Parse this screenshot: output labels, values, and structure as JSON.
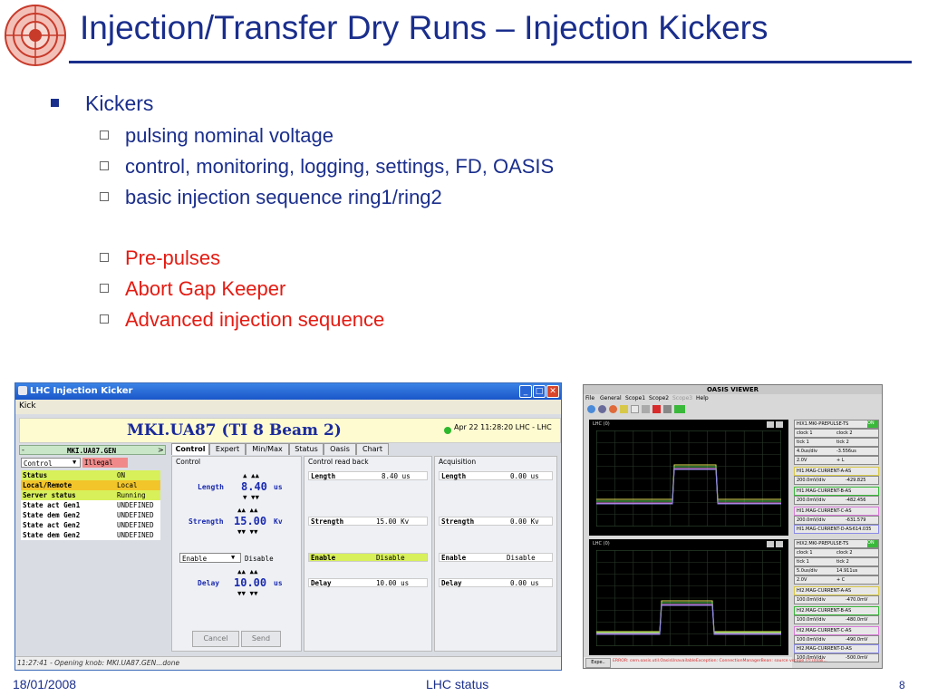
{
  "slide": {
    "title": "Injection/Transfer Dry Runs – Injection Kickers",
    "bullet": "Kickers",
    "sub_blue": [
      "pulsing nominal voltage",
      "control, monitoring, logging, settings, FD, OASIS",
      "basic injection sequence ring1/ring2"
    ],
    "sub_red": [
      "Pre-pulses",
      "Abort Gap Keeper",
      "Advanced injection sequence"
    ]
  },
  "footer": {
    "date": "18/01/2008",
    "center": "LHC status",
    "page": "8"
  },
  "colors": {
    "title_blue": "#1a2e8c",
    "red": "#e41b12"
  },
  "kicker_window": {
    "title": "LHC Injection Kicker",
    "menu": "Kick",
    "header_title": "MKI.UA87 (TI 8 Beam 2)",
    "header_time": "Apr 22 11:28:20  LHC - LHC",
    "device": "MKI.UA87.GEN",
    "mode_select": "Control",
    "mode_state": "Illegal",
    "tabs": [
      "Control",
      "Expert",
      "Min/Max",
      "Status",
      "Oasis",
      "Chart"
    ],
    "status_rows": [
      {
        "label": "Status",
        "value": "ON"
      },
      {
        "label": "Local/Remote",
        "value": "Local"
      },
      {
        "label": "Server status",
        "value": "Running"
      },
      {
        "label": "State act Gen1",
        "value": "UNDEFINED"
      },
      {
        "label": "State dem Gen2",
        "value": "UNDEFINED"
      },
      {
        "label": "State act Gen2",
        "value": "UNDEFINED"
      },
      {
        "label": "State dem Gen2",
        "value": "UNDEFINED"
      }
    ],
    "control": {
      "panel_title": "Control",
      "length_label": "Length",
      "length_value": "8.40",
      "length_unit": "us",
      "strength_label": "Strength",
      "strength_value": "15.00",
      "strength_unit": "Kv",
      "enable_select": "Enable",
      "enable_state": "Disable",
      "delay_label": "Delay",
      "delay_value": "10.00",
      "delay_unit": "us",
      "cancel": "Cancel",
      "send": "Send"
    },
    "readback": {
      "panel_title": "Control read back",
      "rows": [
        [
          "Length",
          "8.40 us"
        ],
        [
          "Strength",
          "15.00 Kv"
        ],
        [
          "Enable",
          "Disable"
        ],
        [
          "Delay",
          "10.00 us"
        ]
      ]
    },
    "acquisition": {
      "panel_title": "Acquisition",
      "rows": [
        [
          "Length",
          "0.00 us"
        ],
        [
          "Strength",
          "0.00 Kv"
        ],
        [
          "Enable",
          "Disable"
        ],
        [
          "Delay",
          "0.00 us"
        ]
      ]
    },
    "status_bar": "11:27:41 - Opening knob: MKI.UA87.GEN...done"
  },
  "oasis_window": {
    "title": "OASIS VIEWER",
    "menu": [
      "File",
      "General",
      "Scope1",
      "Scope2",
      "Scope3",
      "Help"
    ],
    "scope_label": "LHC (0)",
    "scope1": {
      "trigger": "HIX1.MKI-PREPULSE-TS",
      "trigger_state": "ON",
      "rows": [
        [
          "clock 1",
          "clock 2"
        ],
        [
          "tick 1",
          "tick 2"
        ],
        [
          "4.0us/div",
          "-3.556us"
        ],
        [
          "2.0V",
          "+   L"
        ]
      ],
      "channels": [
        {
          "name": "HI1.MAG-CURRENT-A-AS",
          "scale": "200.0mV/div",
          "offset": "-429.825"
        },
        {
          "name": "HI1.MAG-CURRENT-B-AS",
          "scale": "200.0mV/div",
          "offset": "-482.456"
        },
        {
          "name": "HI1.MAG-CURRENT-C-AS",
          "scale": "200.0mV/div",
          "offset": "-631.579"
        },
        {
          "name": "HI1.MAG-CURRENT-D-AS",
          "scale": "200.0mV/div",
          "offset": "-614.035"
        }
      ]
    },
    "scope2": {
      "trigger": "HIX2.MKI-PREPULSE-TS",
      "trigger_state": "ON",
      "rows": [
        [
          "clock 1",
          "clock 2"
        ],
        [
          "tick 1",
          "tick 2"
        ],
        [
          "5.0us/div",
          "14.911us"
        ],
        [
          "2.0V",
          "+   C"
        ]
      ],
      "channels": [
        {
          "name": "HI2.MAG-CURRENT-A-AS",
          "scale": "100.0mV/div",
          "offset": "-470.0mV"
        },
        {
          "name": "HI2.MAG-CURRENT-B-AS",
          "scale": "100.0mV/div",
          "offset": "-480.0mV"
        },
        {
          "name": "HI2.MAG-CURRENT-C-AS",
          "scale": "100.0mV/div",
          "offset": "-490.0mV"
        },
        {
          "name": "HI2.MAG-CURRENT-D-AS",
          "scale": "100.0mV/div",
          "offset": "-500.0mV"
        }
      ]
    },
    "expert_button": "Expe..",
    "error": "ERROR: cern.oasis.util.OasisUnavailableException: ConnectionManagerBean: source vscope (?) invali..."
  }
}
